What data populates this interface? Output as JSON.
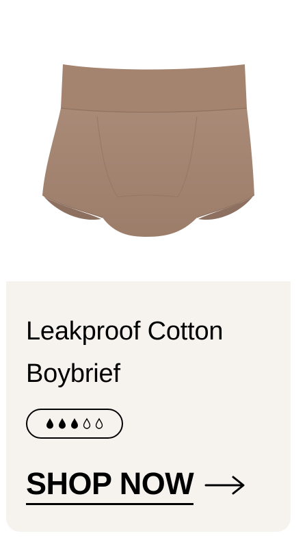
{
  "product": {
    "image_name": "cotton-boybrief-underwear",
    "color": "#a88874",
    "title": "Leakproof Cotton Boybrief",
    "absorbency": {
      "filled": 3,
      "total": 5,
      "icon": "droplet-icon"
    }
  },
  "cta": {
    "label": "SHOP NOW",
    "icon": "arrow-right-icon"
  },
  "colors": {
    "card_background": "#f6f3ef",
    "text": "#000000"
  }
}
